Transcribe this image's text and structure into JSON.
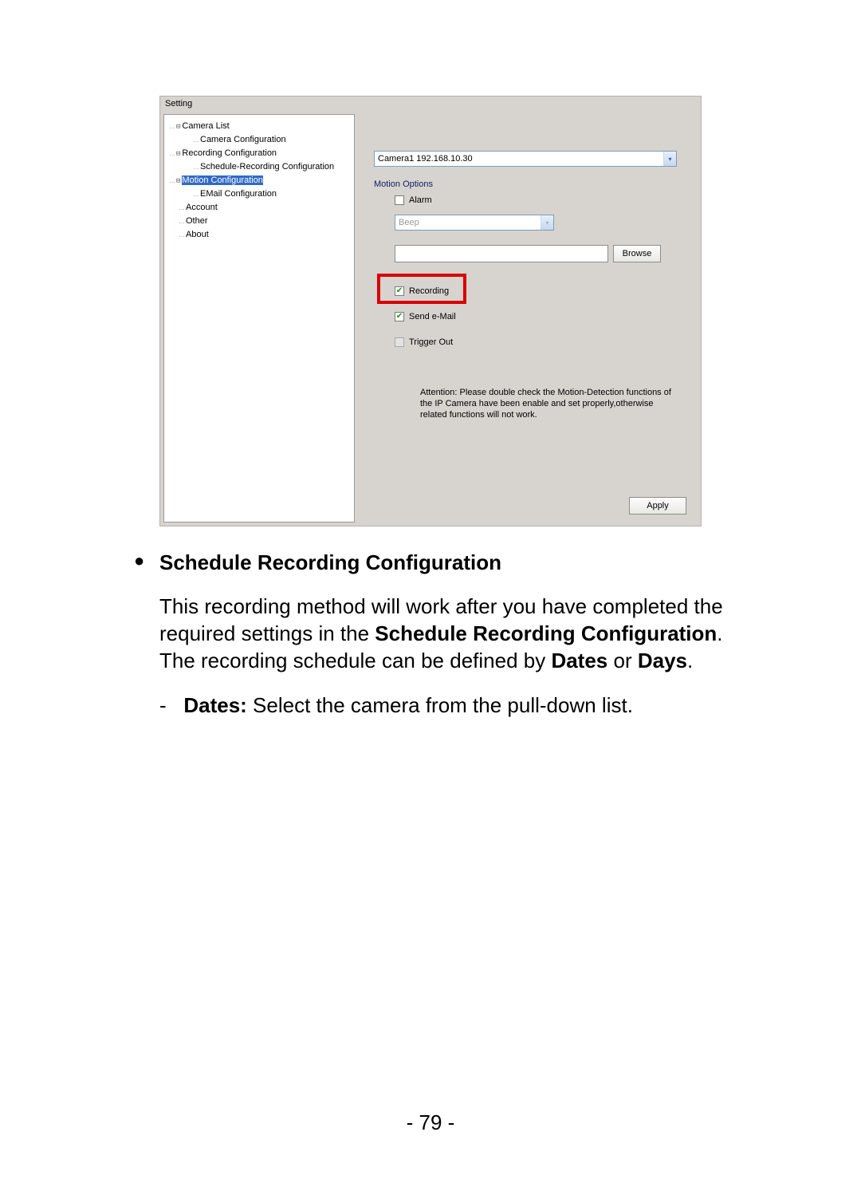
{
  "screenshot": {
    "window_title": "Setting",
    "tree": {
      "camera_list": "Camera List",
      "camera_config": "Camera Configuration",
      "recording_config": "Recording Configuration",
      "schedule_rec_config": "Schedule-Recording Configuration",
      "motion_config": "Motion Configuration",
      "email_config": "EMail Configuration",
      "account": "Account",
      "other": "Other",
      "about": "About"
    },
    "right": {
      "camera_dropdown": "Camera1 192.168.10.30",
      "motion_options_label": "Motion Options",
      "alarm_label": "Alarm",
      "sound_dropdown": "Beep",
      "browse_label": "Browse",
      "recording_label": "Recording",
      "send_email_label": "Send e-Mail",
      "trigger_out_label": "Trigger Out",
      "attention": "Attention: Please double check the Motion-Detection functions of the IP Camera have been enable and set properly,otherwise related functions will not work.",
      "apply_label": "Apply"
    }
  },
  "body_text": {
    "heading": "Schedule Recording Configuration",
    "para_pre": "This recording method will work after you have completed the required settings in the ",
    "para_bold1": "Schedule Recording Configuration",
    "para_mid": ".  The recording schedule can be defined by ",
    "para_bold2": "Dates",
    "para_or": " or ",
    "para_bold3": "Days",
    "para_post": ".",
    "dates_label": "Dates:",
    "dates_text": "  Select the camera from the pull-down list.",
    "page_number": "- 79 -"
  }
}
